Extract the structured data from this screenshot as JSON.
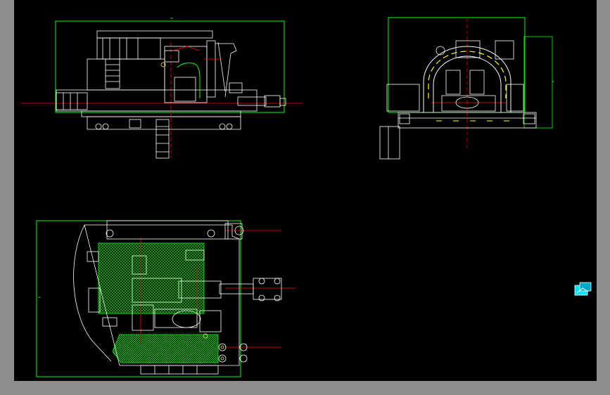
{
  "colors": {
    "background": "#000000",
    "frame": "#8e8e8e",
    "geometry": "#ffffff",
    "centerline": "#ff0000",
    "boundary": "#00ff00",
    "hatch": "#00ff00",
    "accent": "#ffff00",
    "ucs_icon": "#00e5ff"
  },
  "views": {
    "side_view": {
      "dimension_text": "≈"
    },
    "end_view": {
      "dimension_text": "≈"
    },
    "plan_view": {
      "dimension_text": "≈"
    }
  },
  "icons": {
    "ucs": "ucs-icon"
  }
}
